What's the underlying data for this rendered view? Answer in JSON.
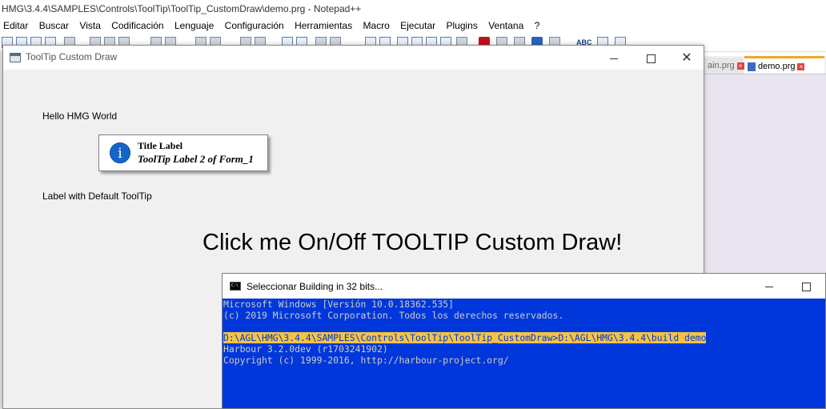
{
  "notepad": {
    "title": "HMG\\3.4.4\\SAMPLES\\Controls\\ToolTip\\ToolTip_CustomDraw\\demo.prg - Notepad++",
    "menu": [
      "Editar",
      "Buscar",
      "Vista",
      "Codificación",
      "Lenguaje",
      "Configuración",
      "Herramientas",
      "Macro",
      "Ejecutar",
      "Plugins",
      "Ventana",
      "?"
    ],
    "tabs": [
      {
        "label": "ain.prg"
      },
      {
        "label": "demo.prg"
      }
    ],
    "toolbar_abc": "ABC"
  },
  "tooltip_window": {
    "title": "ToolTip Custom Draw",
    "label_hello": "Hello HMG World",
    "label_default": "Label with Default ToolTip",
    "big_label": "Click me On/Off TOOLTIP Custom Draw!",
    "tooltip": {
      "icon": "i",
      "title": "Title Label",
      "text": "ToolTip Label 2 of Form_1"
    }
  },
  "console_window": {
    "title": "Seleccionar Building in 32 bits...",
    "lines": [
      "Microsoft Windows [Versión 10.0.18362.535]",
      "(c) 2019 Microsoft Corporation. Todos los derechos reservados.",
      "",
      "D:\\AGL\\HMG\\3.4.4\\SAMPLES\\Controls\\ToolTip\\ToolTip_CustomDraw>D:\\AGL\\HMG\\3.4.4\\build demo",
      "Harbour 3.2.0dev (r1703241902)",
      "Copyright (c) 1999-2016, http://harbour-project.org/"
    ]
  },
  "colors": {
    "console_bg": "#0037da",
    "console_text": "#cccccc",
    "highlight": "#f5c344",
    "info_icon": "#1565c8"
  }
}
